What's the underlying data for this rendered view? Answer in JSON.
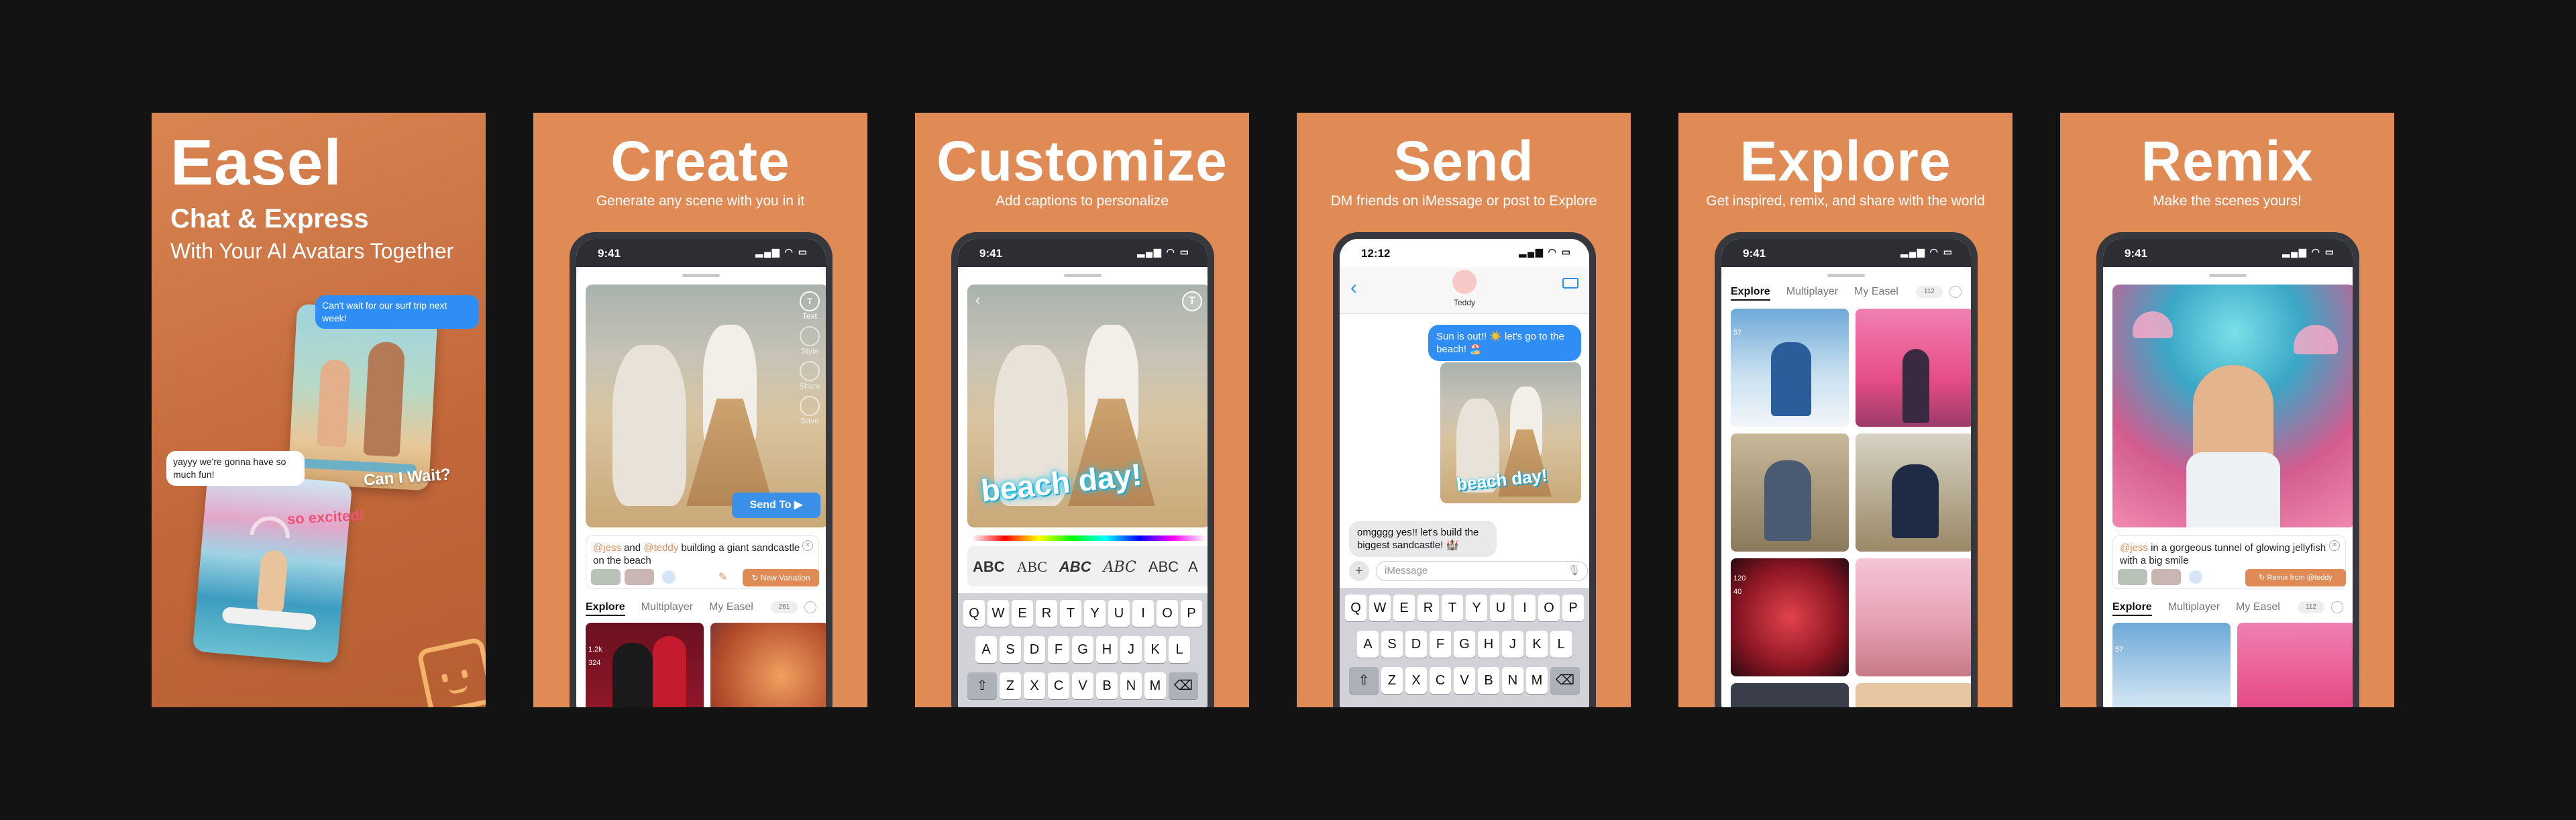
{
  "panel1": {
    "title": "Easel",
    "sub1": "Chat & Express",
    "sub2": "With Your AI Avatars Together",
    "bubble_top": "Can't wait for our surf trip next week!",
    "bubble_left": "yayyy we're gonna have so much fun!",
    "caption_top": "so excited!",
    "caption_bottom": "Can I Wait?"
  },
  "panel2": {
    "title": "Create",
    "sub": "Generate any scene with you in it",
    "time": "9:41",
    "tools": [
      "Text",
      "Style",
      "Share",
      "Save"
    ],
    "send_label": "Send To",
    "prompt_pre": "@jess",
    "prompt_and": " and ",
    "prompt_mention2": "@teddy",
    "prompt_rest": " building a giant sandcastle on the beach",
    "variation": "New Variation",
    "tabs": [
      "Explore",
      "Multiplayer",
      "My Easel"
    ],
    "badge": "261",
    "counts": [
      "1.2k",
      "324"
    ]
  },
  "panel3": {
    "title": "Customize",
    "sub": "Add captions to personalize",
    "time": "9:41",
    "caption": "beach day!",
    "styles": [
      "ABC",
      "ABC",
      "ABC",
      "ABC",
      "ABC",
      "A"
    ],
    "row1": [
      "Q",
      "W",
      "E",
      "R",
      "T",
      "Y",
      "U",
      "I",
      "O",
      "P"
    ],
    "row2": [
      "A",
      "S",
      "D",
      "F",
      "G",
      "H",
      "J",
      "K",
      "L"
    ],
    "row3": [
      "Z",
      "X",
      "C",
      "V",
      "B",
      "N",
      "M"
    ]
  },
  "panel4": {
    "title": "Send",
    "sub": "DM friends on iMessage or post to Explore",
    "time": "12:12",
    "contact": "Teddy",
    "msg_out": "Sun is out!! ☀️ let's go to the beach! 🏖️",
    "img_caption": "beach day!",
    "msg_in": "omgggg yes!! let's build the biggest sandcastle! 🏰",
    "placeholder": "iMessage",
    "row1": [
      "Q",
      "W",
      "E",
      "R",
      "T",
      "Y",
      "U",
      "I",
      "O",
      "P"
    ],
    "row2": [
      "A",
      "S",
      "D",
      "F",
      "G",
      "H",
      "J",
      "K",
      "L"
    ],
    "row3": [
      "Z",
      "X",
      "C",
      "V",
      "B",
      "N",
      "M"
    ]
  },
  "panel5": {
    "title": "Explore",
    "sub": "Get inspired, remix, and share with the world",
    "time": "9:41",
    "tabs": [
      "Explore",
      "Multiplayer",
      "My Easel"
    ],
    "badge": "112",
    "counts": [
      "57",
      "120",
      "40"
    ]
  },
  "panel6": {
    "title": "Remix",
    "sub": "Make the scenes yours!",
    "time": "9:41",
    "prompt_mention": "@jess",
    "prompt_rest": " in a gorgeous tunnel of glowing jellyfish with a big smile",
    "remix": "Remix from @teddy",
    "tabs": [
      "Explore",
      "Multiplayer",
      "My Easel"
    ],
    "badge": "112",
    "counts": [
      "57"
    ]
  }
}
